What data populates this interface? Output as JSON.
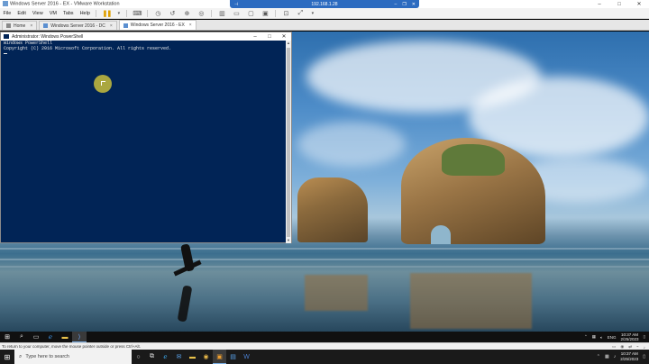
{
  "vmware": {
    "window_title": "Windows Server 2016 - EX - VMware Workstation",
    "menus": [
      "File",
      "Edit",
      "View",
      "VM",
      "Tabs",
      "Help"
    ],
    "tabs": [
      {
        "label": "Home"
      },
      {
        "label": "Windows Server 2016 - DC"
      },
      {
        "label": "Windows Server 2016 - EX"
      }
    ],
    "close_glyph": "×",
    "status_text": "To return to your computer, move the mouse pointer outside or press Ctrl+Alt."
  },
  "remote_bar": {
    "ip": "192.168.1.28"
  },
  "powershell": {
    "title": "Administrator: Windows PowerShell",
    "lines": [
      "Windows PowerShell",
      "Copyright (C) 2016 Microsoft Corporation. All rights reserved.",
      ""
    ]
  },
  "guest_taskbar": {
    "time": "10:37 AM",
    "date": "2/25/2023",
    "lang": "ENG"
  },
  "host_taskbar": {
    "search_placeholder": "Type here to search",
    "time": "10:37 AM",
    "date": "2/25/2023"
  },
  "colors": {
    "ps_background": "#012456",
    "rdp_bar": "#2c6bc0",
    "taskbar": "#101010"
  }
}
